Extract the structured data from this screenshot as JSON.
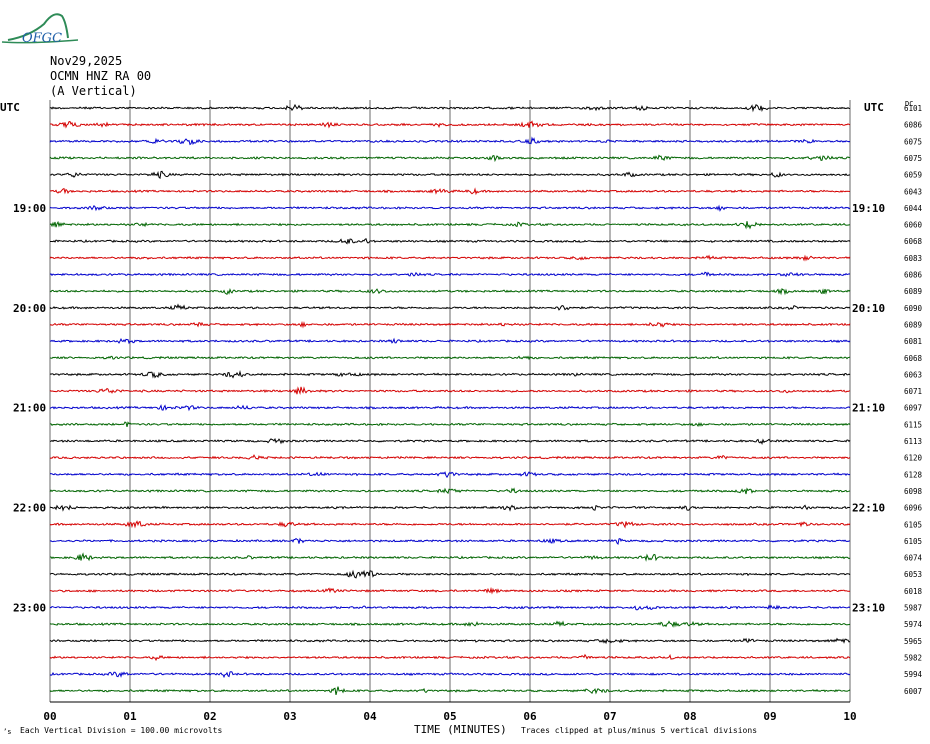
{
  "header": {
    "logo_text": "OFGC",
    "date": "Nov29,2025",
    "station": "OCMN HNZ RA 00",
    "component": "(A Vertical)"
  },
  "labels": {
    "utc_left": "UTC",
    "utc_right": "UTC",
    "dc_header": "DC",
    "x_title": "TIME (MINUTES)",
    "scale_note": "Each Vertical Division =  100.00 microvolts",
    "clip_note": "Traces clipped at plus/minus 5 vertical divisions",
    "corner_mark": "’s"
  },
  "colors": {
    "trace_cycle": [
      "#000000",
      "#d40000",
      "#0000cc",
      "#006400"
    ],
    "grid": "#6a6a6a"
  },
  "chart_data": {
    "type": "line",
    "title": "OCMN HNZ RA 00 (A Vertical) Nov29,2025",
    "xlabel": "TIME (MINUTES)",
    "xlim": [
      0,
      10
    ],
    "x_ticks": [
      "00",
      "01",
      "02",
      "03",
      "04",
      "05",
      "06",
      "07",
      "08",
      "09",
      "10"
    ],
    "left_hour_labels": [
      "19:00",
      "20:00",
      "21:00",
      "22:00",
      "23:00"
    ],
    "right_hour_labels": [
      "19:10",
      "20:10",
      "21:10",
      "22:10",
      "23:10"
    ],
    "hour_label_trace_index": [
      6,
      12,
      18,
      24,
      30
    ],
    "trace_count": 36,
    "minutes_per_trace": 10,
    "dc_offsets": [
      6101,
      6086,
      6075,
      6075,
      6059,
      6043,
      6044,
      6060,
      6068,
      6083,
      6086,
      6089,
      6090,
      6089,
      6081,
      6068,
      6063,
      6071,
      6097,
      6115,
      6113,
      6120,
      6128,
      6098,
      6096,
      6105,
      6105,
      6074,
      6053,
      6018,
      5987,
      5974,
      5965,
      5982,
      5994,
      6007
    ],
    "vertical_division_microvolts": 100.0,
    "clip_divisions": 5,
    "grid": true
  }
}
